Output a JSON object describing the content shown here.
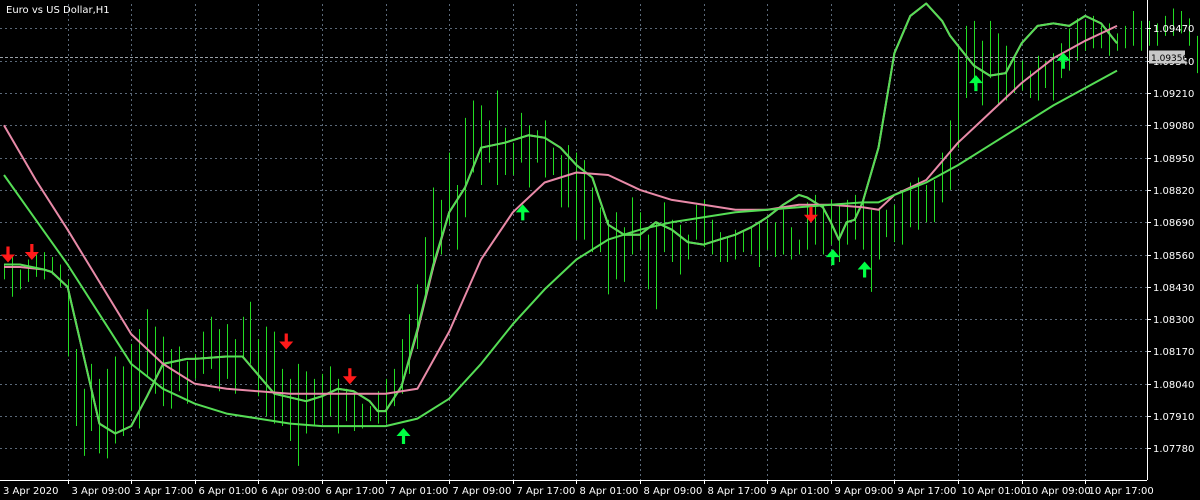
{
  "chart_data": {
    "type": "line",
    "title": "Euro vs US Dollar,H1",
    "current_price": "1.09356",
    "current_price_value": 1.09356,
    "ylim": [
      1.07653,
      1.09568
    ],
    "y_ticks": [
      "1.09470",
      "1.09340",
      "1.09210",
      "1.09080",
      "1.08950",
      "1.08820",
      "1.08690",
      "1.08560",
      "1.08430",
      "1.08300",
      "1.08170",
      "1.08040",
      "1.07910",
      "1.07780"
    ],
    "y_tick_values": [
      1.0947,
      1.0934,
      1.0921,
      1.0908,
      1.0895,
      1.0882,
      1.0869,
      1.0856,
      1.0843,
      1.083,
      1.0817,
      1.0804,
      1.0791,
      1.0778
    ],
    "x_ticks": [
      "3 Apr 2020",
      "3 Apr 09:00",
      "3 Apr 17:00",
      "6 Apr 01:00",
      "6 Apr 09:00",
      "6 Apr 17:00",
      "7 Apr 01:00",
      "7 Apr 09:00",
      "7 Apr 17:00",
      "8 Apr 01:00",
      "8 Apr 09:00",
      "8 Apr 17:00",
      "9 Apr 01:00",
      "9 Apr 09:00",
      "9 Apr 17:00",
      "10 Apr 01:00",
      "10 Apr 09:00",
      "10 Apr 17:00"
    ],
    "x_tick_bars": [
      0,
      8,
      16,
      24,
      32,
      40,
      48,
      56,
      64,
      72,
      80,
      88,
      96,
      104,
      112,
      120,
      128,
      136
    ],
    "grid": true,
    "colors": {
      "background": "#000000",
      "grid": "#5a6878",
      "bars": "#22dd22",
      "pink_line": "#e88aa8",
      "green_line": "#55dd55",
      "up_arrow": "#00ff44",
      "down_arrow": "#ff1a1a",
      "axis_text": "#ffffff",
      "price_tag_bg": "#c8c8c8"
    },
    "bars": [
      [
        1.0852,
        1.0846
      ],
      [
        1.0856,
        1.0839
      ],
      [
        1.085,
        1.0842
      ],
      [
        1.0854,
        1.0845
      ],
      [
        1.0856,
        1.0847
      ],
      [
        1.0857,
        1.0846
      ],
      [
        1.0855,
        1.0848
      ],
      [
        1.0852,
        1.0843
      ],
      [
        1.0846,
        1.0815
      ],
      [
        1.0818,
        1.0787
      ],
      [
        1.0802,
        1.0775
      ],
      [
        1.0812,
        1.0785
      ],
      [
        1.0806,
        1.0776
      ],
      [
        1.081,
        1.0774
      ],
      [
        1.0815,
        1.078
      ],
      [
        1.0811,
        1.0783
      ],
      [
        1.082,
        1.0793
      ],
      [
        1.0826,
        1.0786
      ],
      [
        1.0834,
        1.0807
      ],
      [
        1.0827,
        1.08
      ],
      [
        1.0823,
        1.0795
      ],
      [
        1.0818,
        1.0794
      ],
      [
        1.0819,
        1.0801
      ],
      [
        1.0813,
        1.0796
      ],
      [
        1.0816,
        1.0806
      ],
      [
        1.0825,
        1.0808
      ],
      [
        1.0831,
        1.081
      ],
      [
        1.0826,
        1.0801
      ],
      [
        1.0828,
        1.0806
      ],
      [
        1.0822,
        1.08
      ],
      [
        1.0831,
        1.0815
      ],
      [
        1.0837,
        1.0812
      ],
      [
        1.0822,
        1.0799
      ],
      [
        1.0827,
        1.0791
      ],
      [
        1.0825,
        1.0788
      ],
      [
        1.081,
        1.0787
      ],
      [
        1.0806,
        1.0781
      ],
      [
        1.0812,
        1.0771
      ],
      [
        1.0809,
        1.0784
      ],
      [
        1.0806,
        1.0787
      ],
      [
        1.0808,
        1.0788
      ],
      [
        1.0811,
        1.0791
      ],
      [
        1.0806,
        1.0784
      ],
      [
        1.0802,
        1.0789
      ],
      [
        1.08,
        1.0785
      ],
      [
        1.0796,
        1.0786
      ],
      [
        1.0795,
        1.0789
      ],
      [
        1.0801,
        1.0788
      ],
      [
        1.0806,
        1.0788
      ],
      [
        1.081,
        1.0795
      ],
      [
        1.0822,
        1.08
      ],
      [
        1.0832,
        1.0808
      ],
      [
        1.0844,
        1.0818
      ],
      [
        1.0863,
        1.0838
      ],
      [
        1.0883,
        1.085
      ],
      [
        1.0878,
        1.0856
      ],
      [
        1.0897,
        1.0868
      ],
      [
        1.0884,
        1.0858
      ],
      [
        1.0911,
        1.0871
      ],
      [
        1.0918,
        1.0889
      ],
      [
        1.0916,
        1.0884
      ],
      [
        1.091,
        1.0893
      ],
      [
        1.0922,
        1.0884
      ],
      [
        1.0907,
        1.0888
      ],
      [
        1.0901,
        1.0888
      ],
      [
        1.0913,
        1.0893
      ],
      [
        1.0908,
        1.0883
      ],
      [
        1.0906,
        1.0893
      ],
      [
        1.091,
        1.0887
      ],
      [
        1.0899,
        1.0888
      ],
      [
        1.0896,
        1.0875
      ],
      [
        1.09,
        1.0875
      ],
      [
        1.0897,
        1.0862
      ],
      [
        1.0894,
        1.0862
      ],
      [
        1.0883,
        1.0857
      ],
      [
        1.0875,
        1.0857
      ],
      [
        1.087,
        1.084
      ],
      [
        1.0873,
        1.0846
      ],
      [
        1.0867,
        1.0845
      ],
      [
        1.0879,
        1.0856
      ],
      [
        1.0873,
        1.0858
      ],
      [
        1.0864,
        1.0842
      ],
      [
        1.0869,
        1.0834
      ],
      [
        1.0877,
        1.0857
      ],
      [
        1.087,
        1.0853
      ],
      [
        1.0868,
        1.0848
      ],
      [
        1.0864,
        1.0854
      ],
      [
        1.0876,
        1.0862
      ],
      [
        1.0878,
        1.0859
      ],
      [
        1.087,
        1.0856
      ],
      [
        1.0865,
        1.0853
      ],
      [
        1.0863,
        1.0853
      ],
      [
        1.0866,
        1.0854
      ],
      [
        1.0865,
        1.0857
      ],
      [
        1.0867,
        1.0856
      ],
      [
        1.0869,
        1.0851
      ],
      [
        1.087,
        1.0858
      ],
      [
        1.0869,
        1.0855
      ],
      [
        1.0874,
        1.0856
      ],
      [
        1.0867,
        1.0854
      ],
      [
        1.0862,
        1.0856
      ],
      [
        1.0877,
        1.0858
      ],
      [
        1.088,
        1.086
      ],
      [
        1.0876,
        1.0856
      ],
      [
        1.0878,
        1.086
      ],
      [
        1.0876,
        1.0853
      ],
      [
        1.0878,
        1.086
      ],
      [
        1.088,
        1.0862
      ],
      [
        1.0879,
        1.0858
      ],
      [
        1.0874,
        1.0841
      ],
      [
        1.0875,
        1.0854
      ],
      [
        1.0874,
        1.0863
      ],
      [
        1.0876,
        1.0861
      ],
      [
        1.0882,
        1.086
      ],
      [
        1.0885,
        1.0867
      ],
      [
        1.0887,
        1.0866
      ],
      [
        1.0884,
        1.0869
      ],
      [
        1.0886,
        1.0869
      ],
      [
        1.0897,
        1.0877
      ],
      [
        1.091,
        1.0882
      ],
      [
        1.094,
        1.0899
      ],
      [
        1.0948,
        1.0919
      ],
      [
        1.095,
        1.0924
      ],
      [
        1.0942,
        1.0916
      ],
      [
        1.095,
        1.0927
      ],
      [
        1.0945,
        1.0916
      ],
      [
        1.094,
        1.0918
      ],
      [
        1.0935,
        1.0921
      ],
      [
        1.0934,
        1.0922
      ],
      [
        1.093,
        1.0919
      ],
      [
        1.0936,
        1.0918
      ],
      [
        1.0934,
        1.0923
      ],
      [
        1.0937,
        1.0918
      ],
      [
        1.0941,
        1.0927
      ],
      [
        1.0947,
        1.093
      ],
      [
        1.0951,
        1.0934
      ],
      [
        1.095,
        1.0938
      ],
      [
        1.0952,
        1.0939
      ],
      [
        1.0948,
        1.0939
      ],
      [
        1.0949,
        1.0936
      ],
      [
        1.0945,
        1.0938
      ],
      [
        1.0948,
        1.0939
      ],
      [
        1.0954,
        1.094
      ],
      [
        1.095,
        1.0938
      ],
      [
        1.095,
        1.094
      ],
      [
        1.0949,
        1.094
      ],
      [
        1.0952,
        1.0944
      ],
      [
        1.0955,
        1.0944
      ],
      [
        1.0954,
        1.0945
      ],
      [
        1.0951,
        1.094
      ],
      [
        1.0944,
        1.0929
      ],
      [
        1.0944,
        1.0936
      ],
      [
        1.0942,
        1.0934
      ],
      [
        1.0939,
        1.0931
      ]
    ],
    "series": [
      {
        "color": "#e88aa8",
        "x": [
          0,
          2,
          5,
          6,
          8,
          12,
          14,
          16,
          18,
          20,
          23,
          24,
          28,
          30,
          34,
          38,
          40,
          42,
          44,
          46,
          47,
          48,
          50,
          52,
          54,
          56,
          58,
          60,
          63,
          66,
          68,
          70,
          72,
          74,
          76,
          78,
          80,
          82,
          84,
          86,
          88,
          90,
          92,
          94,
          96,
          98,
          100,
          101,
          102,
          103,
          104,
          105,
          106,
          107,
          108,
          110,
          112,
          114,
          116,
          118,
          119,
          120,
          122,
          124,
          126,
          128,
          130,
          132,
          134,
          136,
          138,
          140
        ],
        "y": [
          1.0851,
          1.0851,
          1.085,
          1.0849,
          1.0843,
          1.0788,
          1.0784,
          1.0787,
          1.0799,
          1.0812,
          1.0814,
          1.0814,
          1.0815,
          1.0815,
          1.08,
          1.0797,
          1.0799,
          1.0802,
          1.0801,
          1.0797,
          1.0793,
          1.0793,
          1.0803,
          1.0825,
          1.0851,
          1.0873,
          1.0883,
          1.0899,
          1.0901,
          1.0904,
          1.0903,
          1.0899,
          1.0892,
          1.0887,
          1.0868,
          1.0864,
          1.0864,
          1.0869,
          1.0866,
          1.0861,
          1.086,
          1.0862,
          1.0864,
          1.0867,
          1.0871,
          1.0876,
          1.088,
          1.0879,
          1.0877,
          1.0875,
          1.0869,
          1.0862,
          1.0869,
          1.087,
          1.0877,
          1.0899,
          1.0937,
          1.0952,
          1.0957,
          1.095,
          1.0944,
          1.094,
          1.0932,
          1.0928,
          1.0929,
          1.0941,
          1.0948,
          1.0949,
          1.0948,
          1.0952,
          1.0949,
          1.0941
        ]
      },
      {
        "color": "#55dd55",
        "x": [
          0,
          2,
          5,
          6,
          8,
          12,
          14,
          16,
          18,
          20,
          23,
          24,
          28,
          30,
          34,
          38,
          40,
          42,
          44,
          46,
          47,
          48,
          50,
          52,
          54,
          56,
          58,
          60,
          63,
          66,
          68,
          70,
          72,
          74,
          76,
          78,
          80,
          82,
          84,
          86,
          88,
          90,
          92,
          94,
          96,
          98,
          100,
          101,
          102,
          103,
          104,
          105,
          106,
          107,
          108,
          110,
          112,
          114,
          116,
          118,
          119,
          120,
          122,
          124,
          126,
          128,
          130,
          132,
          134,
          136,
          138,
          140
        ],
        "y": [
          1.0852,
          1.0852,
          1.085,
          1.0849,
          1.0843,
          1.0788,
          1.0784,
          1.0787,
          1.0799,
          1.0812,
          1.0814,
          1.0814,
          1.0815,
          1.0815,
          1.08,
          1.0797,
          1.0799,
          1.0802,
          1.0801,
          1.0797,
          1.0793,
          1.0793,
          1.0803,
          1.0826,
          1.0852,
          1.0873,
          1.0883,
          1.0899,
          1.0901,
          1.0904,
          1.0903,
          1.0899,
          1.0892,
          1.0887,
          1.0868,
          1.0864,
          1.0864,
          1.0869,
          1.0866,
          1.0861,
          1.086,
          1.0862,
          1.0864,
          1.0867,
          1.0871,
          1.0876,
          1.088,
          1.0879,
          1.0877,
          1.0875,
          1.0869,
          1.0862,
          1.0869,
          1.087,
          1.0877,
          1.0899,
          1.0937,
          1.0952,
          1.0957,
          1.095,
          1.0944,
          1.094,
          1.0932,
          1.0928,
          1.0929,
          1.0941,
          1.0948,
          1.0949,
          1.0948,
          1.0952,
          1.0949,
          1.0941
        ]
      },
      {
        "color": "#e88aa8",
        "x": [
          0,
          4,
          8,
          12,
          16,
          20,
          24,
          28,
          32,
          36,
          40,
          44,
          48,
          52,
          56,
          60,
          64,
          68,
          72,
          76,
          80,
          84,
          88,
          92,
          96,
          100,
          104,
          108,
          110,
          112,
          116,
          120,
          124,
          128,
          132,
          136,
          140
        ],
        "y": [
          1.0908,
          1.0886,
          1.0866,
          1.0845,
          1.0824,
          1.0812,
          1.0804,
          1.0802,
          1.0801,
          1.08,
          1.08,
          1.08,
          1.08,
          1.0802,
          1.0825,
          1.0854,
          1.0873,
          1.0885,
          1.0889,
          1.0888,
          1.0882,
          1.0878,
          1.0876,
          1.0874,
          1.0874,
          1.0876,
          1.0876,
          1.0875,
          1.0874,
          1.088,
          1.0886,
          1.0901,
          1.0913,
          1.0925,
          1.0935,
          1.0942,
          1.0948
        ]
      },
      {
        "color": "#55dd55",
        "x": [
          0,
          4,
          8,
          12,
          16,
          20,
          24,
          28,
          32,
          36,
          40,
          44,
          48,
          52,
          56,
          60,
          64,
          68,
          72,
          76,
          80,
          84,
          88,
          92,
          96,
          100,
          104,
          108,
          110,
          112,
          116,
          120,
          124,
          128,
          132,
          136,
          140
        ],
        "y": [
          1.0888,
          1.087,
          1.0852,
          1.0832,
          1.0812,
          1.0802,
          1.0796,
          1.0792,
          1.079,
          1.0788,
          1.0787,
          1.0787,
          1.0787,
          1.079,
          1.0798,
          1.0812,
          1.0828,
          1.0842,
          1.0854,
          1.0862,
          1.0866,
          1.0869,
          1.0871,
          1.0873,
          1.0874,
          1.0875,
          1.0876,
          1.0877,
          1.0877,
          1.088,
          1.0885,
          1.0892,
          1.09,
          1.0908,
          1.0916,
          1.0923,
          1.093
        ]
      }
    ],
    "arrows_down": [
      [
        0,
        1.0852
      ],
      [
        3,
        1.0853
      ],
      [
        35,
        1.0817
      ],
      [
        43,
        1.0803
      ],
      [
        101,
        1.0868
      ]
    ],
    "arrows_up": [
      [
        50,
        1.0787
      ],
      [
        65,
        1.0877
      ],
      [
        104,
        1.0859
      ],
      [
        108,
        1.0854
      ],
      [
        122,
        1.0929
      ],
      [
        133,
        1.0938
      ]
    ]
  }
}
